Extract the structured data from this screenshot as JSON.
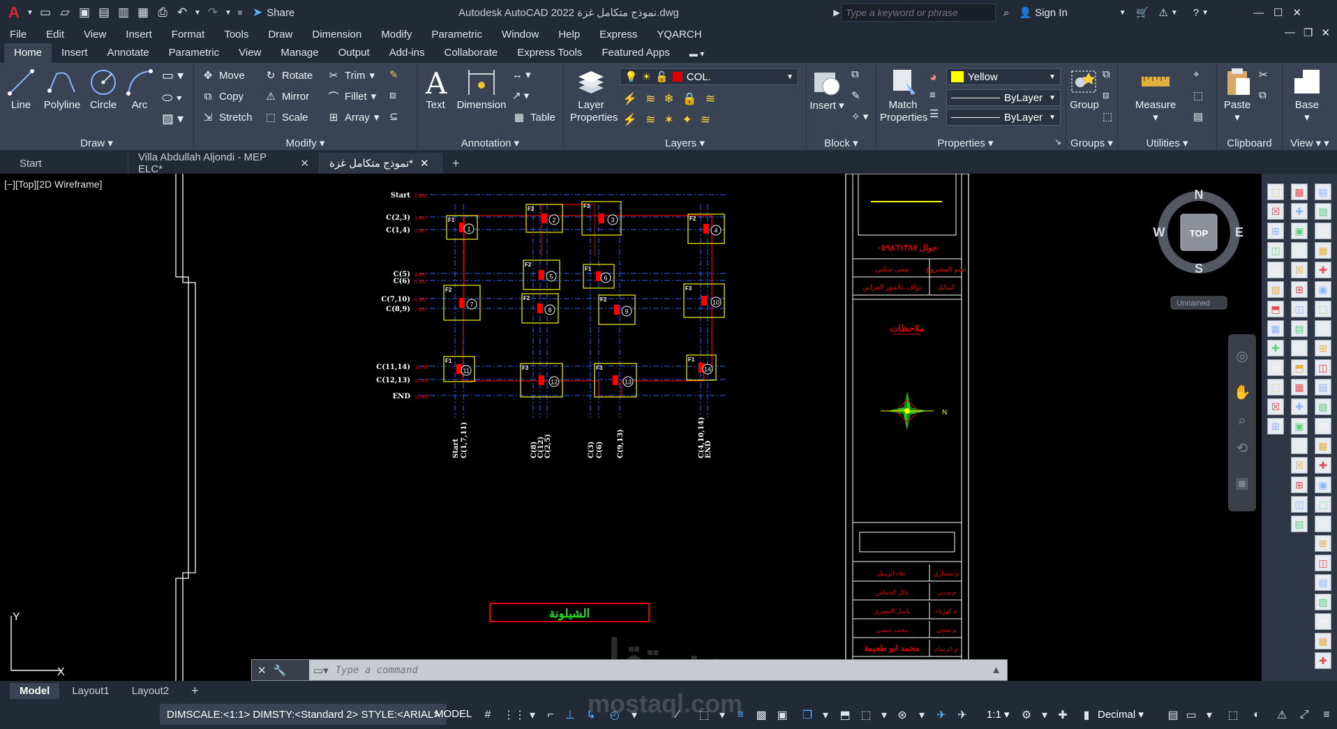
{
  "titlebar": {
    "app_title": "Autodesk AutoCAD 2022  نموذج متكامل غزة.dwg",
    "share_label": "Share",
    "search_placeholder": "Type a keyword or phrase",
    "signin_label": "Sign In"
  },
  "menubar": {
    "items": [
      "File",
      "Edit",
      "View",
      "Insert",
      "Format",
      "Tools",
      "Draw",
      "Dimension",
      "Modify",
      "Parametric",
      "Window",
      "Help",
      "Express",
      "YQARCH"
    ]
  },
  "ribbon_tabs": {
    "items": [
      "Home",
      "Insert",
      "Annotate",
      "Parametric",
      "View",
      "Manage",
      "Output",
      "Add-ins",
      "Collaborate",
      "Express Tools",
      "Featured Apps"
    ],
    "active": "Home"
  },
  "ribbon": {
    "draw": {
      "title": "Draw",
      "line": "Line",
      "polyline": "Polyline",
      "circle": "Circle",
      "arc": "Arc"
    },
    "modify": {
      "title": "Modify",
      "move": "Move",
      "rotate": "Rotate",
      "trim": "Trim",
      "copy": "Copy",
      "mirror": "Mirror",
      "fillet": "Fillet",
      "stretch": "Stretch",
      "scale": "Scale",
      "array": "Array"
    },
    "annotation": {
      "title": "Annotation",
      "text": "Text",
      "dimension": "Dimension",
      "table": "Table"
    },
    "layers": {
      "title": "Layers",
      "layer_properties": "Layer Properties",
      "current_layer": "COL."
    },
    "block": {
      "title": "Block",
      "insert": "Insert"
    },
    "properties": {
      "title": "Properties",
      "match": "Match Properties",
      "color": "Yellow",
      "linetype": "ByLayer",
      "lineweight": "ByLayer"
    },
    "groups": {
      "title": "Groups",
      "group": "Group"
    },
    "utilities": {
      "title": "Utilities",
      "measure": "Measure"
    },
    "clipboard": {
      "title": "Clipboard",
      "paste": "Paste"
    },
    "view": {
      "title": "View",
      "base": "Base"
    }
  },
  "doc_tabs": {
    "items": [
      "Start",
      "Villa Abdullah Aljondi - MEP ELC*",
      "نموذج متكامل غزة*"
    ]
  },
  "canvas": {
    "view_label": "[−][Top][2D Wireframe]",
    "viewcube": {
      "n": "N",
      "s": "S",
      "e": "E",
      "w": "W",
      "top": "TOP",
      "ucs": "Unnamed"
    },
    "ucs_y": "Y",
    "ucs_x": "X",
    "left_labels": [
      "Start",
      "C(2,3)",
      "C(1,4)",
      "C(5)",
      "C(6)",
      "C(7,10)",
      "C(8,9)",
      "C(11,14)",
      "C(12,13)",
      "END"
    ],
    "left_values": [
      "0.000",
      "1.407",
      "2.107",
      "4.457",
      "5.107",
      "6.457",
      "7.057",
      "10.707",
      "11.407",
      "12.457"
    ],
    "bottom_labels": [
      "Start",
      "C(1,7,11)",
      "C(8)",
      "C(12)",
      "C(2,5)",
      "C(3)",
      "C(6)",
      "C(9,13)",
      "C(4,10,14)",
      "END"
    ],
    "footings": [
      {
        "type": "F1",
        "num": "1"
      },
      {
        "type": "F2",
        "num": "2"
      },
      {
        "type": "F3",
        "num": "3"
      },
      {
        "type": "F2",
        "num": "4"
      },
      {
        "type": "F2",
        "num": "5"
      },
      {
        "type": "F1",
        "num": "6"
      },
      {
        "type": "F2",
        "num": "7"
      },
      {
        "type": "F2",
        "num": "8"
      },
      {
        "type": "F2",
        "num": "9"
      },
      {
        "type": "F3",
        "num": "10"
      },
      {
        "type": "F1",
        "num": "11"
      },
      {
        "type": "F3",
        "num": "12"
      },
      {
        "type": "F3",
        "num": "13"
      },
      {
        "type": "F1",
        "num": "14"
      }
    ],
    "sheet_title": "الشيلونة",
    "titleblock": {
      "phone": "جوال ٠٥٩٨٦١٣٨٧",
      "row1_label": "اسم المشروع",
      "row1_value": "مبنى سكني",
      "row2_label": "المالك",
      "row2_value": "نواف عاشور العرابي",
      "notes": "ملاحظات",
      "north": "N",
      "sig": [
        {
          "label": "م معماري",
          "value": "علاء الزميل"
        },
        {
          "label": "م مدني",
          "value": "نائل الخماش"
        },
        {
          "label": "م كهرباء",
          "value": "باسل المصري"
        },
        {
          "label": "م صحي",
          "value": "محمد عيسى"
        },
        {
          "label": "م الرسام",
          "value": "محمد ابو طعيمة"
        }
      ]
    }
  },
  "command": {
    "placeholder": "Type a command"
  },
  "layout_tabs": {
    "items": [
      "Model",
      "Layout1",
      "Layout2"
    ],
    "active": "Model"
  },
  "statusbar": {
    "sysvars": "DIMSCALE:<1:1> DIMSTY:<Standard 2> STYLE:<ARIAL>",
    "model": "MODEL",
    "scale": "1:1",
    "units": "Decimal"
  },
  "watermark": {
    "arabic": "مستقل",
    "latin": "mostaql.com"
  },
  "colors": {
    "bg_dark": "#232a37",
    "ribbon": "#3a4354",
    "canvas": "#000000",
    "accent_red": "#d8282f",
    "footing_yellow": "#e6e600",
    "beam_red": "#e00000",
    "axis_blue": "#3060ff"
  }
}
